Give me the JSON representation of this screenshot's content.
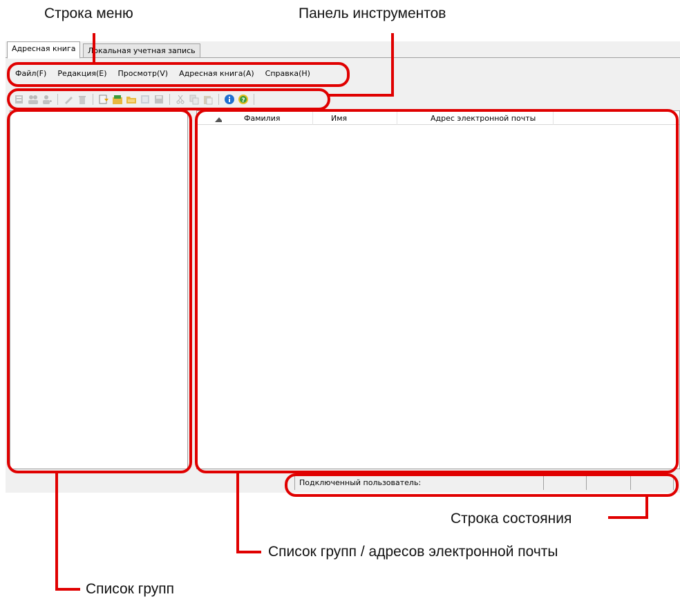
{
  "annotations": {
    "menu_bar": "Строка меню",
    "toolbar": "Панель инструментов",
    "status_bar": "Строка состояния",
    "group_address_list": "Список групп / адресов электронной почты",
    "group_list": "Список групп"
  },
  "tabs": [
    {
      "label": "Адресная книга",
      "active": true
    },
    {
      "label": "Локальная учетная запись",
      "active": false
    }
  ],
  "menu": [
    "Файл(F)",
    "Редакция(E)",
    "Просмотр(V)",
    "Адресная книга(A)",
    "Справка(H)"
  ],
  "toolbar_icons": [
    "new-contact-icon",
    "new-group-icon",
    "add-member-icon",
    "edit-icon",
    "delete-icon",
    "import-icon",
    "export-icon",
    "open-folder-icon",
    "copy-book-icon",
    "save-icon",
    "cut-icon",
    "copy-icon",
    "paste-icon",
    "info-icon",
    "help-icon"
  ],
  "list_columns": [
    "Фамилия",
    "Имя",
    "Адрес электронной почты"
  ],
  "status": {
    "connected_user_label": "Подключенный пользователь:"
  },
  "colors": {
    "highlight": "#e00000"
  }
}
